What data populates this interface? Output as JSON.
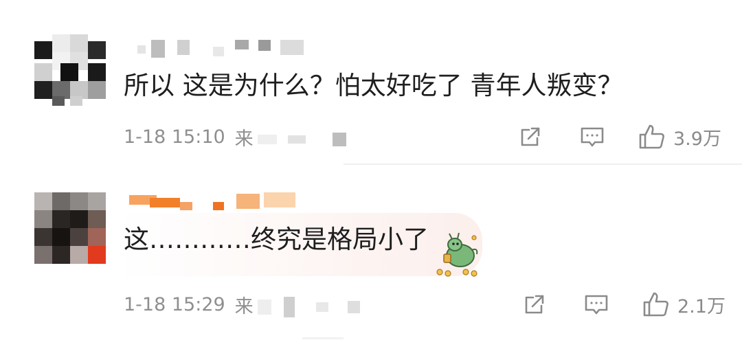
{
  "comments": [
    {
      "text": "所以 这是为什么？怕太好吃了 青年人叛变？",
      "time": "1-18 15:10",
      "source_prefix": "来",
      "likes": "3.9万",
      "icons": {
        "share": "share-icon",
        "reply": "comment-icon",
        "like": "thumbs-up-icon"
      }
    },
    {
      "text": "这…………终究是格局小了",
      "time": "1-18 15:29",
      "source_prefix": "来",
      "likes": "2.1万",
      "sticker": "dragon-sticker",
      "icons": {
        "share": "share-icon",
        "reply": "comment-icon",
        "like": "thumbs-up-icon"
      }
    }
  ],
  "colors": {
    "text": "#1e1e1e",
    "meta": "#8f8f8f",
    "icon": "#8a8a8a",
    "username_highlight": "#f5822a"
  }
}
